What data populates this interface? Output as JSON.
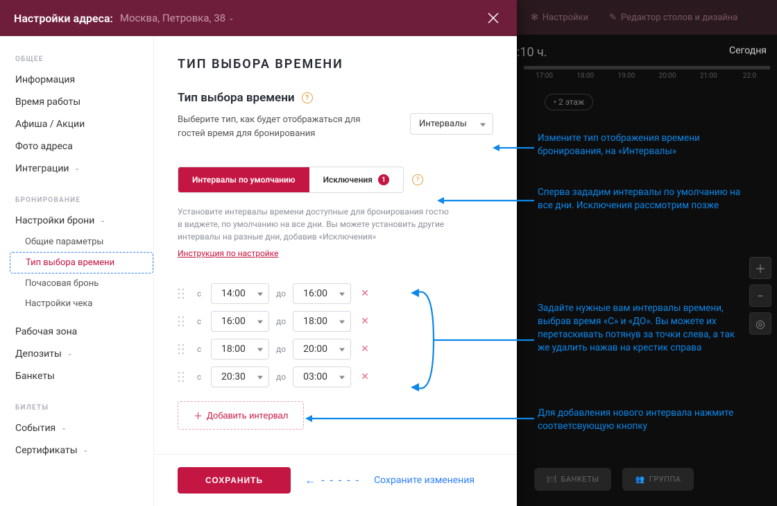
{
  "header": {
    "title": "Настройки адреса:",
    "address": "Москва, Петровка, 38"
  },
  "bg": {
    "top_items": [
      "Настройки",
      "Редактор столов и дизайна"
    ],
    "time_big": ":10 ч.",
    "today": "Сегодня",
    "ticks": [
      "17:00",
      "18:00",
      "19:00",
      "20:00",
      "21:00",
      "22:0"
    ],
    "floor": "• 2 этаж",
    "bottom_btns": [
      "БАНКЕТЫ",
      "ГРУППА"
    ]
  },
  "sidebar": {
    "groups": [
      {
        "label": "ОБЩЕЕ",
        "items": [
          {
            "label": "Информация"
          },
          {
            "label": "Время работы"
          },
          {
            "label": "Афиша / Акции"
          },
          {
            "label": "Фото адреса"
          },
          {
            "label": "Интеграции",
            "exp": true
          }
        ]
      },
      {
        "label": "БРОНИРОВАНИЕ",
        "items": [
          {
            "label": "Настройки брони",
            "exp": true,
            "sub": [
              {
                "label": "Общие параметры"
              },
              {
                "label": "Тип выбора времени",
                "active": true
              },
              {
                "label": "Почасовая бронь"
              },
              {
                "label": "Настройки чека"
              }
            ]
          },
          {
            "label": "Рабочая зона"
          },
          {
            "label": "Депозиты",
            "exp": true
          },
          {
            "label": "Банкеты"
          }
        ]
      },
      {
        "label": "БИЛЕТЫ",
        "items": [
          {
            "label": "События",
            "exp": true
          },
          {
            "label": "Сертификаты",
            "exp": true
          }
        ]
      }
    ]
  },
  "main": {
    "h1": "ТИП ВЫБОРА ВРЕМЕНИ",
    "h2": "Тип выбора времени",
    "type_desc": "Выберите тип, как будет отображаться для гостей время для бронирования",
    "type_select": "Интервалы",
    "tabs": {
      "default": "Интервалы по умолчанию",
      "except": "Исключения",
      "except_count": "1"
    },
    "hint": "Установите интервалы времени доступные для бронирования гостю в виджете, по умолчанию на все дни. Вы можете установить другие интервалы на разные дни, добавив «Исключения»",
    "link": "Инструкция по настройке",
    "from_label": "с",
    "to_label": "до",
    "intervals": [
      {
        "from": "14:00",
        "to": "16:00"
      },
      {
        "from": "16:00",
        "to": "18:00"
      },
      {
        "from": "18:00",
        "to": "20:00"
      },
      {
        "from": "20:30",
        "to": "03:00"
      }
    ],
    "add_btn": "Добавить интервал",
    "save_btn": "СОХРАНИТЬ",
    "save_hint": "Сохраните изменения"
  },
  "annotations": {
    "a1": "Измените тип отображения времени бронирования, на «Интервалы»",
    "a2": "Сперва зададим интервалы по умолчанию на все дни. Исключения рассмотрим позже",
    "a3": "Задайте нужные вам интервалы времени, выбрав время «С» и «ДО». Вы можете их перетаскивать потянув за точки слева, а так же удалить нажав на крестик справа",
    "a4": "Для добавления нового интервала нажмите соответсвующую кнопку"
  }
}
